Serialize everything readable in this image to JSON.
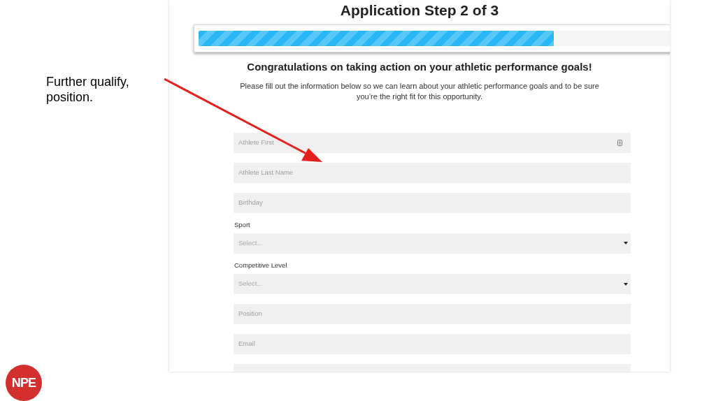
{
  "note": "Further qualify, position.",
  "logo": "NPE",
  "form": {
    "title": "Application Step 2 of 3",
    "progress": {
      "level": 0.75
    },
    "heading": "Congratulations on taking action on your athletic performance goals!",
    "intro": "Please fill out the information below so we can learn about your athletic performance goals and to be sure you’re the right fit for this opportunity.",
    "fields": [
      {
        "kind": "text",
        "placeholder": "Athlete First",
        "autofill_icon": true
      },
      {
        "kind": "text",
        "placeholder": "Athlete Last Name",
        "autofill_icon": false
      },
      {
        "kind": "text",
        "placeholder": "Birthday",
        "autofill_icon": false
      },
      {
        "kind": "select",
        "label": "Sport",
        "placeholder": "Select..."
      },
      {
        "kind": "select",
        "label": "Competitive Level",
        "placeholder": "Select..."
      },
      {
        "kind": "text",
        "placeholder": "Position",
        "autofill_icon": false
      },
      {
        "kind": "text",
        "placeholder": "Email",
        "autofill_icon": false
      },
      {
        "kind": "cut"
      }
    ]
  }
}
